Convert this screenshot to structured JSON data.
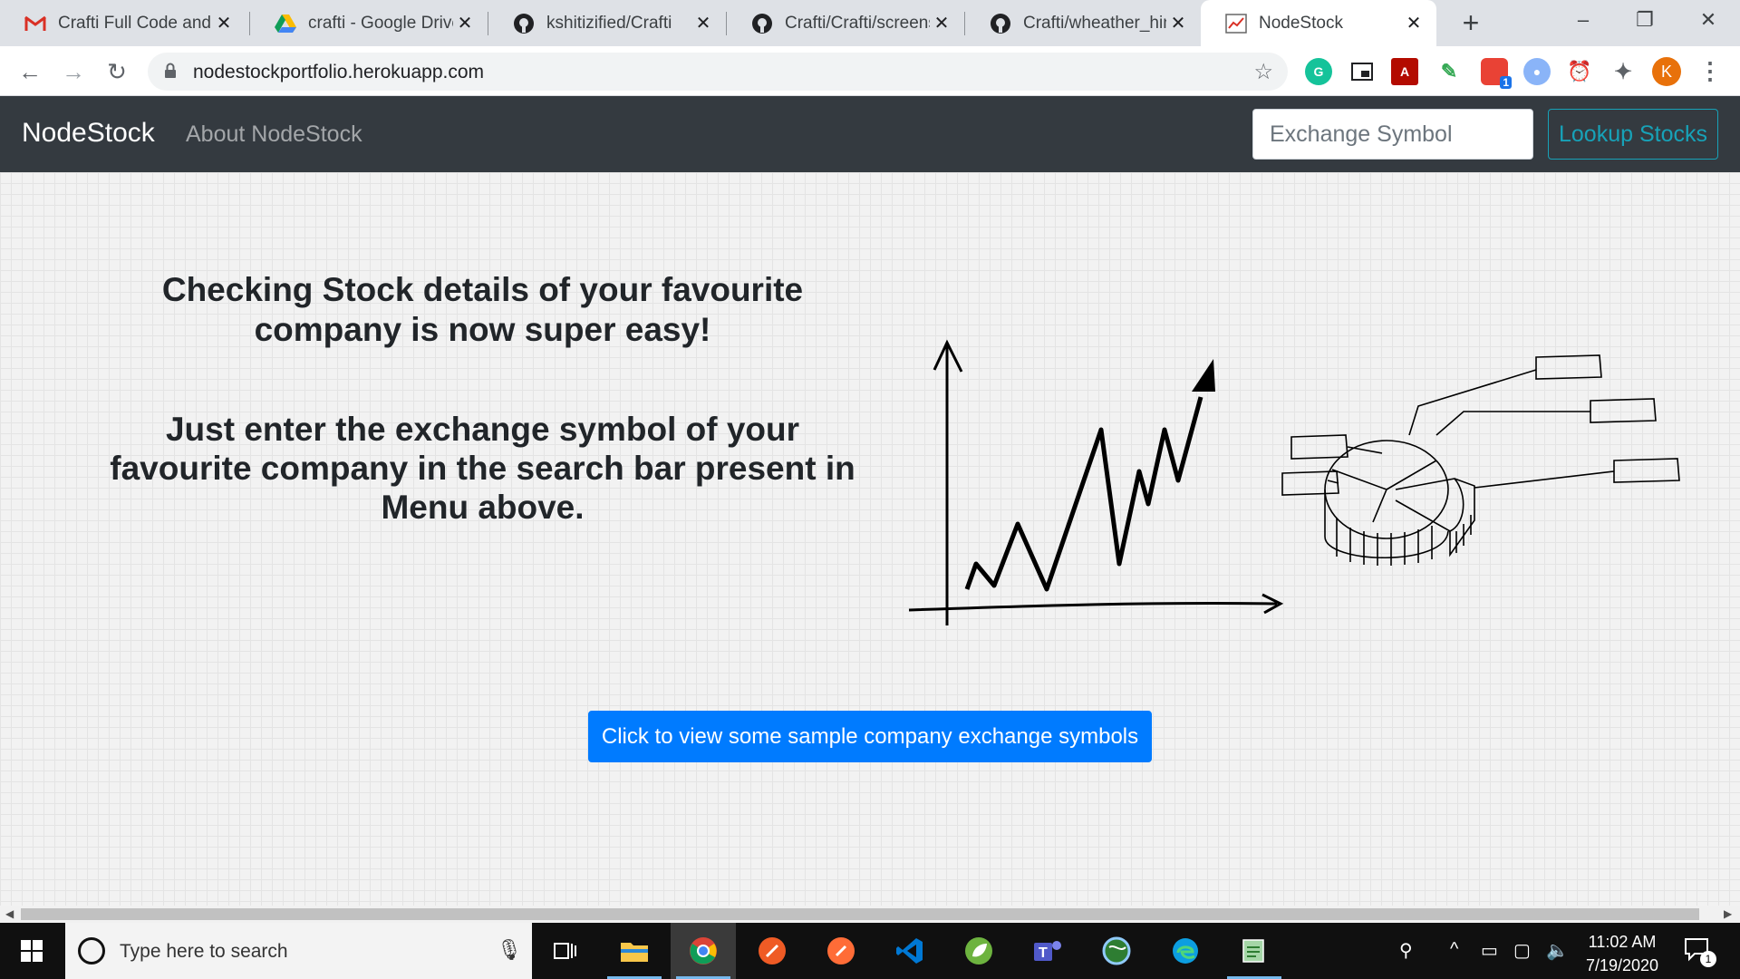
{
  "browser": {
    "tabs": [
      {
        "title": "Crafti Full Code and S",
        "icon": "gmail-icon"
      },
      {
        "title": "crafti - Google Drive",
        "icon": "google-drive-icon"
      },
      {
        "title": "kshitizified/Crafti",
        "icon": "github-icon"
      },
      {
        "title": "Crafti/Crafti/screensh",
        "icon": "github-icon"
      },
      {
        "title": "Crafti/wheather_hind",
        "icon": "github-icon"
      },
      {
        "title": "NodeStock",
        "icon": "nodestock-favicon",
        "active": true
      }
    ],
    "url": "nodestockportfolio.herokuapp.com",
    "profile_initial": "K",
    "extension_badge": "1"
  },
  "navbar": {
    "brand": "NodeStock",
    "about_link": "About NodeStock",
    "search_placeholder": "Exchange Symbol",
    "lookup_button": "Lookup Stocks"
  },
  "main": {
    "headline": "Checking Stock details of your favourite company is now super easy!",
    "instruction": "Just enter the exchange symbol of your favourite company in the search bar present in Menu above.",
    "sample_button": "Click to view some sample company exchange symbols"
  },
  "taskbar": {
    "search_placeholder": "Type here to search",
    "time": "11:02 AM",
    "date": "7/19/2020",
    "notification_count": "1",
    "pinned": [
      "task-view-icon",
      "file-explorer-icon",
      "chrome-icon",
      "postman-icon",
      "postman-app-icon",
      "vscode-icon",
      "spring-tools-icon",
      "teams-icon",
      "globe-icon",
      "edge-icon",
      "notepad-icon"
    ]
  },
  "colors": {
    "navbar_bg": "#343a40",
    "lookup_outline": "#17a2b8",
    "primary_button": "#007bff"
  }
}
